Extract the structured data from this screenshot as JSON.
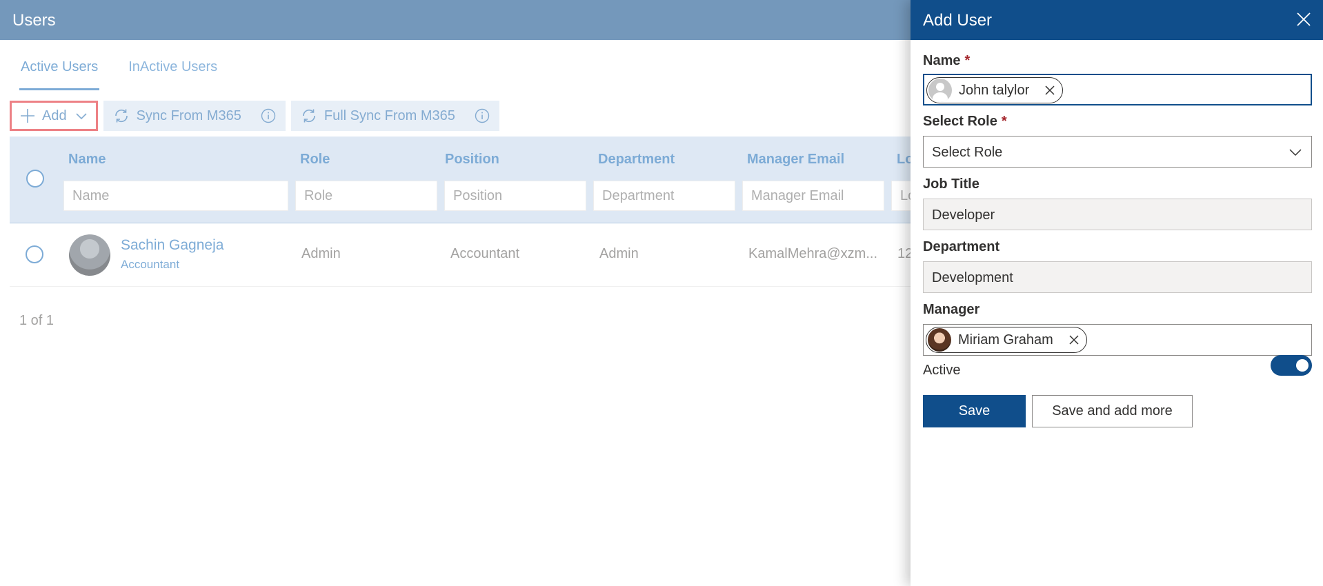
{
  "header": {
    "title": "Users"
  },
  "tabs": [
    {
      "label": "Active Users",
      "active": true
    },
    {
      "label": "InActive Users",
      "active": false
    }
  ],
  "toolbar": {
    "add_label": "Add",
    "sync_label": "Sync From M365",
    "full_sync_label": "Full Sync From M365"
  },
  "grid": {
    "columns": [
      "Name",
      "Role",
      "Position",
      "Department",
      "Manager Email",
      "Lo"
    ],
    "filter_placeholders": [
      "Name",
      "Role",
      "Position",
      "Department",
      "Manager Email",
      "Lo"
    ],
    "rows": [
      {
        "name": "Sachin Gagneja",
        "subtitle": "Accountant",
        "role": "Admin",
        "position": "Accountant",
        "department": "Admin",
        "manager_email": "KamalMehra@xzm...",
        "extra": "12"
      }
    ]
  },
  "pager": {
    "text": "1 of 1"
  },
  "panel": {
    "title": "Add User",
    "name_label": "Name",
    "name_value": "John talylor",
    "role_label": "Select Role",
    "role_value": "Select Role",
    "job_title_label": "Job Title",
    "job_title_value": "Developer",
    "department_label": "Department",
    "department_value": "Development",
    "manager_label": "Manager",
    "manager_value": "Miriam Graham",
    "active_label": "Active",
    "active_on": true,
    "save_label": "Save",
    "save_more_label": "Save and add more",
    "required_mark": "*"
  },
  "colors": {
    "primary": "#104e8b",
    "link": "#1f6fb8",
    "highlight": "#e0262d",
    "required": "#a4262c"
  },
  "icons": [
    "plus-icon",
    "chevron-down-icon",
    "sync-icon",
    "info-icon",
    "close-icon",
    "remove-icon"
  ]
}
